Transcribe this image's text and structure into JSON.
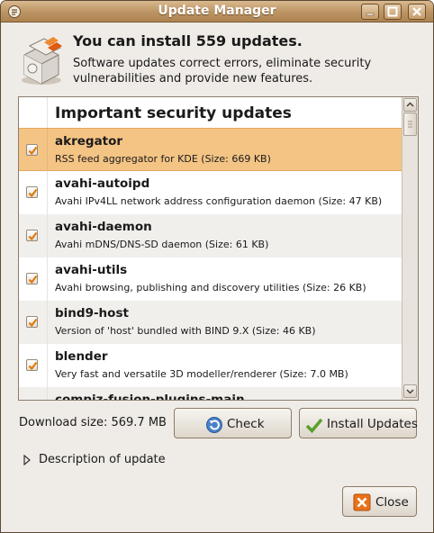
{
  "window": {
    "title": "Update Manager"
  },
  "header": {
    "headline": "You can install 559 updates.",
    "subline": "Software updates correct errors, eliminate security vulnerabilities and provide new features."
  },
  "list": {
    "section_title": "Important security updates",
    "items": [
      {
        "name": "akregator",
        "desc": "RSS feed aggregator for KDE (Size: 669 KB)",
        "checked": true,
        "selected": true
      },
      {
        "name": "avahi-autoipd",
        "desc": "Avahi IPv4LL network address configuration daemon (Size: 47 KB)",
        "checked": true,
        "selected": false
      },
      {
        "name": "avahi-daemon",
        "desc": "Avahi mDNS/DNS-SD daemon (Size: 61 KB)",
        "checked": true,
        "selected": false
      },
      {
        "name": "avahi-utils",
        "desc": "Avahi browsing, publishing and discovery utilities (Size: 26 KB)",
        "checked": true,
        "selected": false
      },
      {
        "name": "bind9-host",
        "desc": "Version of 'host' bundled with BIND 9.X (Size: 46 KB)",
        "checked": true,
        "selected": false
      },
      {
        "name": "blender",
        "desc": "Very fast and versatile 3D modeller/renderer (Size: 7.0 MB)",
        "checked": true,
        "selected": false
      },
      {
        "name": "compiz-fusion-plugins-main",
        "desc": "",
        "checked": true,
        "selected": false
      }
    ]
  },
  "footer": {
    "download_size": "Download size: 569.7 MB",
    "check_label": "Check",
    "install_label": "Install Updates",
    "description_label": "Description of update",
    "close_label": "Close"
  },
  "colors": {
    "titlebar": "#bc9463",
    "selection": "#f4c485",
    "check_orange": "#e07a10"
  }
}
